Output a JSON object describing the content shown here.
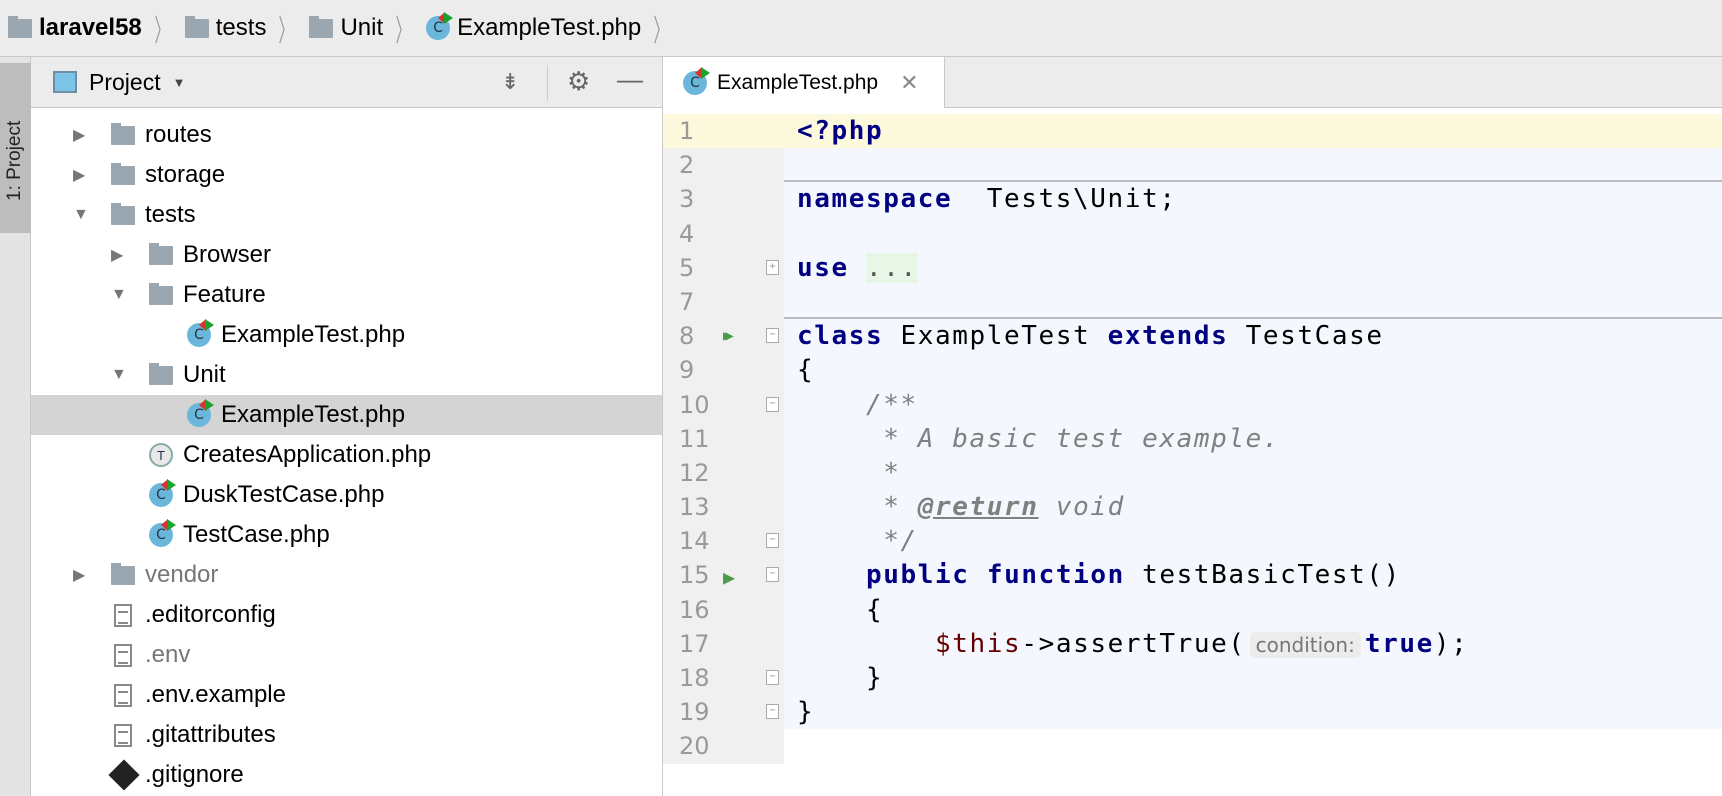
{
  "breadcrumbs": [
    {
      "label": "laravel58",
      "icon": "folder-icon"
    },
    {
      "label": "tests",
      "icon": "folder-icon"
    },
    {
      "label": "Unit",
      "icon": "folder-icon"
    },
    {
      "label": "ExampleTest.php",
      "icon": "php-class-icon"
    }
  ],
  "side_strip": {
    "tab": "1: Project"
  },
  "project_panel": {
    "title": "Project",
    "tree": [
      {
        "label": "routes",
        "type": "folder",
        "level": 0,
        "expander": "collapsed"
      },
      {
        "label": "storage",
        "type": "folder",
        "level": 0,
        "expander": "collapsed"
      },
      {
        "label": "tests",
        "type": "folder",
        "level": 0,
        "expander": "expanded"
      },
      {
        "label": "Browser",
        "type": "folder",
        "level": 1,
        "expander": "collapsed"
      },
      {
        "label": "Feature",
        "type": "folder",
        "level": 1,
        "expander": "expanded"
      },
      {
        "label": "ExampleTest.php",
        "type": "class",
        "level": 2
      },
      {
        "label": "Unit",
        "type": "folder",
        "level": 1,
        "expander": "expanded"
      },
      {
        "label": "ExampleTest.php",
        "type": "class",
        "level": 2,
        "selected": true
      },
      {
        "label": "CreatesApplication.php",
        "type": "trait",
        "level": 1
      },
      {
        "label": "DuskTestCase.php",
        "type": "class",
        "level": 1
      },
      {
        "label": "TestCase.php",
        "type": "class",
        "level": 1
      },
      {
        "label": "vendor",
        "type": "folder",
        "level": 0,
        "expander": "collapsed",
        "dim": true
      },
      {
        "label": ".editorconfig",
        "type": "file",
        "level": 0
      },
      {
        "label": ".env",
        "type": "file",
        "level": 0,
        "dim": true
      },
      {
        "label": ".env.example",
        "type": "file",
        "level": 0
      },
      {
        "label": ".gitattributes",
        "type": "file",
        "level": 0
      },
      {
        "label": ".gitignore",
        "type": "git",
        "level": 0
      }
    ]
  },
  "editor": {
    "tab": "ExampleTest.php",
    "lines": [
      {
        "n": "1",
        "t": [
          [
            "kw",
            "<?php"
          ]
        ]
      },
      {
        "n": "2",
        "t": []
      },
      {
        "n": "3",
        "t": [
          [
            "kw",
            "namespace"
          ],
          [
            "",
            "  Tests\\Unit;"
          ]
        ]
      },
      {
        "n": "4",
        "t": []
      },
      {
        "n": "5",
        "t": [
          [
            "kw",
            "use"
          ],
          [
            "",
            " "
          ],
          [
            "fd",
            "..."
          ]
        ]
      },
      {
        "n": "7",
        "t": []
      },
      {
        "n": "8",
        "t": [
          [
            "kw",
            "class"
          ],
          [
            "",
            " ExampleTest "
          ],
          [
            "kw",
            "extends"
          ],
          [
            "",
            " TestCase"
          ]
        ]
      },
      {
        "n": "9",
        "t": [
          [
            "",
            "{"
          ]
        ]
      },
      {
        "n": "10",
        "t": [
          [
            "cm",
            "    /**"
          ]
        ]
      },
      {
        "n": "11",
        "t": [
          [
            "cm",
            "     * A basic test example."
          ]
        ]
      },
      {
        "n": "12",
        "t": [
          [
            "cm",
            "     *"
          ]
        ]
      },
      {
        "n": "13",
        "t": [
          [
            "cm",
            "     * "
          ],
          [
            "tag",
            "@return"
          ],
          [
            "cm",
            " void"
          ]
        ]
      },
      {
        "n": "14",
        "t": [
          [
            "cm",
            "     */"
          ]
        ]
      },
      {
        "n": "15",
        "t": [
          [
            "kw",
            "    public"
          ],
          [
            "",
            " "
          ],
          [
            "kw",
            "function"
          ],
          [
            "",
            " testBasicTest()"
          ]
        ]
      },
      {
        "n": "16",
        "t": [
          [
            "",
            "    {"
          ]
        ]
      },
      {
        "n": "17",
        "t": [
          [
            "",
            "        "
          ],
          [
            "var",
            "$this"
          ],
          [
            "",
            "->assertTrue("
          ],
          [
            "hint",
            "condition:"
          ],
          [
            "kw",
            "true"
          ],
          [
            "",
            ");"
          ]
        ]
      },
      {
        "n": "18",
        "t": [
          [
            "",
            "    }"
          ]
        ]
      },
      {
        "n": "19",
        "t": [
          [
            "",
            "}"
          ]
        ]
      },
      {
        "n": "20",
        "t": []
      }
    ]
  }
}
